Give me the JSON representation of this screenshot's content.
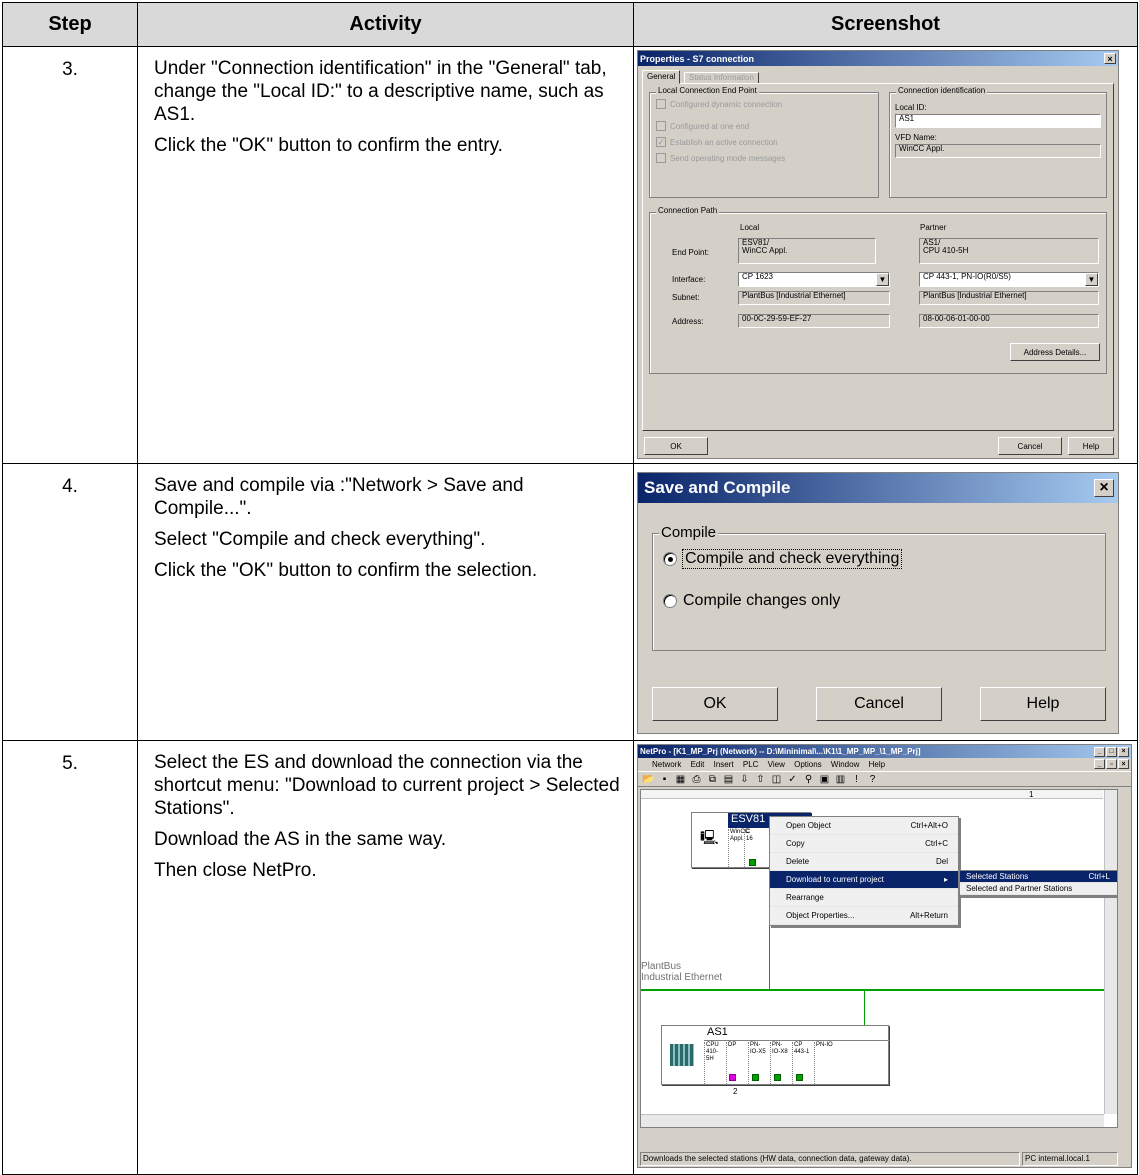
{
  "headers": {
    "step": "Step",
    "activity": "Activity",
    "screenshot": "Screenshot"
  },
  "rows": [
    {
      "step": "3.",
      "lines": [
        "Under \"Connection identification\" in the \"General\" tab, change the \"Local ID:\" to a descriptive name, such as AS1.",
        "Click the \"OK\" button to confirm the entry."
      ]
    },
    {
      "step": "4.",
      "lines": [
        "Save and compile via :\"Network > Save and Compile...\".",
        "Select \"Compile and check everything\".",
        "Click the \"OK\" button to confirm the selection."
      ]
    },
    {
      "step": "5.",
      "lines": [
        "Select the ES and download the connection via the shortcut menu: \"Download to current project > Selected Stations\".",
        "Download the AS in the same way.",
        "Then close NetPro."
      ]
    }
  ],
  "props": {
    "title": "Properties - S7 connection",
    "close": "×",
    "tabs": [
      "General",
      "Status Information"
    ],
    "local_end_point": {
      "label": "Local Connection End Point",
      "options": [
        {
          "label": "Configured dynamic connection",
          "checked": false
        },
        {
          "label": "Configured at one end",
          "checked": false
        },
        {
          "label": "Establish an active connection",
          "checked": true
        },
        {
          "label": "Send operating mode messages",
          "checked": false
        }
      ]
    },
    "conn_id": {
      "label": "Connection identification",
      "local_id_label": "Local ID:",
      "local_id_value": "AS1",
      "vfd_label": "VFD Name:",
      "vfd_value": "WinCC Appl."
    },
    "path": {
      "label": "Connection Path",
      "local_header": "Local",
      "partner_header": "Partner",
      "end_point_label": "End Point:",
      "end_point_local": "ESV81/\nWinCC Appl.",
      "end_point_partner": "AS1/\nCPU 410-5H",
      "interface_label": "Interface:",
      "interface_local": "CP 1623",
      "interface_partner": "CP 443-1, PN-IO(R0/S5)",
      "subnet_label": "Subnet:",
      "subnet_local": "PlantBus [Industrial Ethernet]",
      "subnet_partner": "PlantBus [Industrial Ethernet]",
      "address_label": "Address:",
      "address_local": "00-0C-29-59-EF-27",
      "address_partner": "08-00-06-01-00-00",
      "address_details": "Address Details..."
    },
    "ok": "OK",
    "cancel": "Cancel",
    "help": "Help"
  },
  "compile": {
    "title": "Save and Compile",
    "close": "×",
    "group": "Compile",
    "options": [
      {
        "label": "Compile and check everything",
        "selected": true
      },
      {
        "label": "Compile changes only",
        "selected": false
      }
    ],
    "ok": "OK",
    "cancel": "Cancel",
    "help": "Help"
  },
  "netpro": {
    "title": "NetPro - [K1_MP_Prj (Network) -- D:\\Mininimal\\...\\K1\\1_MP_MP_\\1_MP_Prj]",
    "menu": [
      "Network",
      "Edit",
      "Insert",
      "PLC",
      "View",
      "Options",
      "Window",
      "Help"
    ],
    "toolbar_icons": [
      "new-icon",
      "save-icon",
      "config-icon",
      "print-icon",
      "copy-icon",
      "paste-icon",
      "download-icon",
      "upload-icon",
      "diagnose-icon",
      "check-icon",
      "link-icon",
      "properties-icon",
      "catalog-icon",
      "exclam-icon",
      "help-pointer-icon"
    ],
    "ruler_number": "1",
    "es_station": {
      "name": "ESV81",
      "slots": [
        "WinCC\nAppl.",
        "C\n16"
      ]
    },
    "context_menu": [
      {
        "label": "Open Object",
        "shortcut": "Ctrl+Alt+O"
      },
      {
        "label": "Copy",
        "shortcut": "Ctrl+C"
      },
      {
        "label": "Delete",
        "shortcut": "Del"
      },
      {
        "label": "Download to current project",
        "shortcut": "▸",
        "selected": true
      },
      {
        "label": "Rearrange",
        "shortcut": ""
      },
      {
        "label": "Object Properties...",
        "shortcut": "Alt+Return"
      }
    ],
    "submenu": [
      {
        "label": "Selected Stations",
        "shortcut": "Ctrl+L",
        "selected": true
      },
      {
        "label": "Selected and Partner Stations",
        "shortcut": ""
      }
    ],
    "bus_label_1": "PlantBus",
    "bus_label_2": "Industrial Ethernet",
    "as_station": {
      "name": "AS1",
      "slots": [
        "CPU\n410-5H",
        "DP",
        "PN-\nIO-X5",
        "PN-\nIO-X8",
        "CP\n443-1",
        "PN-IO"
      ],
      "rack_number": "2"
    },
    "status_text": "Downloads the selected stations (HW data, connection data, gateway data).",
    "status_right": "PC internal.local.1",
    "colors": {
      "bus": "#00a000",
      "title_start": "#0a246a",
      "title_end": "#a6caf0"
    }
  }
}
